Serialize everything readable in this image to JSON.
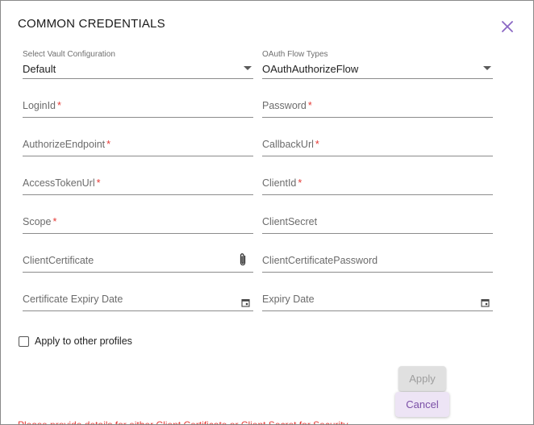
{
  "dialog": {
    "title": "COMMON CREDENTIALS",
    "close_icon": "close-icon"
  },
  "vault": {
    "label": "Select Vault Configuration",
    "value": "Default",
    "options_visible": [
      "Default"
    ]
  },
  "oauth_flow": {
    "label": "OAuth Flow Types",
    "value": "OAuthAuthorizeFlow",
    "options_visible": [
      "OAuthAuthorizeFlow"
    ]
  },
  "fields": {
    "login_id": {
      "label": "LoginId",
      "required": "*"
    },
    "password": {
      "label": "Password",
      "required": "*"
    },
    "authorize_endpoint": {
      "label": "AuthorizeEndpoint",
      "required": "*"
    },
    "callback_url": {
      "label": "CallbackUrl",
      "required": "*"
    },
    "access_token_url": {
      "label": "AccessTokenUrl",
      "required": "*"
    },
    "client_id": {
      "label": "ClientId",
      "required": "*"
    },
    "scope": {
      "label": "Scope",
      "required": "*"
    },
    "client_secret": {
      "label": "ClientSecret"
    },
    "client_certificate": {
      "label": "ClientCertificate",
      "icon": "paperclip-icon"
    },
    "client_certificate_password": {
      "label": "ClientCertificatePassword"
    },
    "certificate_expiry_date": {
      "label": "Certificate Expiry Date",
      "icon": "calendar-icon"
    },
    "expiry_date": {
      "label": "Expiry Date",
      "icon": "calendar-icon"
    }
  },
  "apply_other_profiles": {
    "label": "Apply to other profiles",
    "checked": false
  },
  "buttons": {
    "apply": "Apply",
    "cancel": "Cancel"
  },
  "error": {
    "text": "Please provide details for either Client Certificate or Client Secret for Security"
  },
  "colors": {
    "required": "#e53935",
    "accent": "#7a4fa6",
    "close": "#8b67c4"
  }
}
